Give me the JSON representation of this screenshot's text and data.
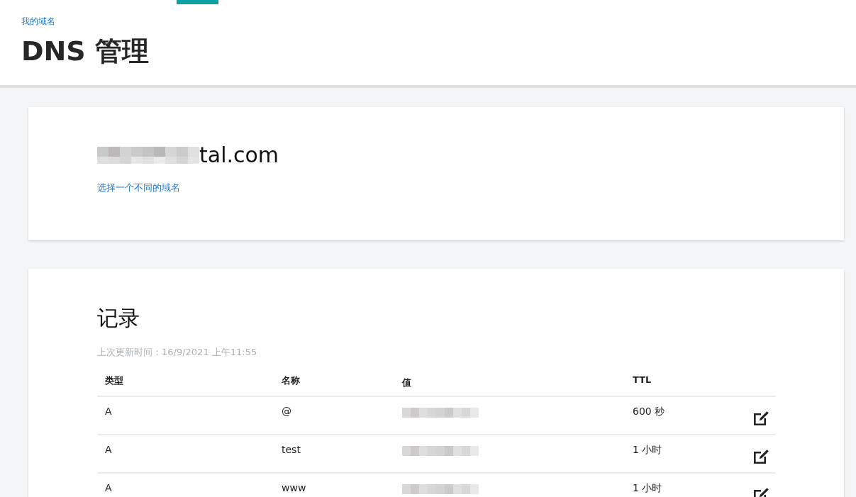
{
  "header": {
    "breadcrumb": "我的域名",
    "title": "DNS 管理"
  },
  "domain_card": {
    "domain": "tal.com",
    "change_link": "选择一个不同的域名"
  },
  "records": {
    "title": "记录",
    "updated": "上次更新时间：16/9/2021 上午11:55",
    "columns": [
      "类型",
      "名称",
      "值",
      "TTL"
    ],
    "rows": [
      {
        "type": "A",
        "name": "@",
        "ttl": "600 秒"
      },
      {
        "type": "A",
        "name": "test",
        "ttl": "1 小时"
      },
      {
        "type": "A",
        "name": "www",
        "ttl": "1 小时"
      }
    ]
  }
}
